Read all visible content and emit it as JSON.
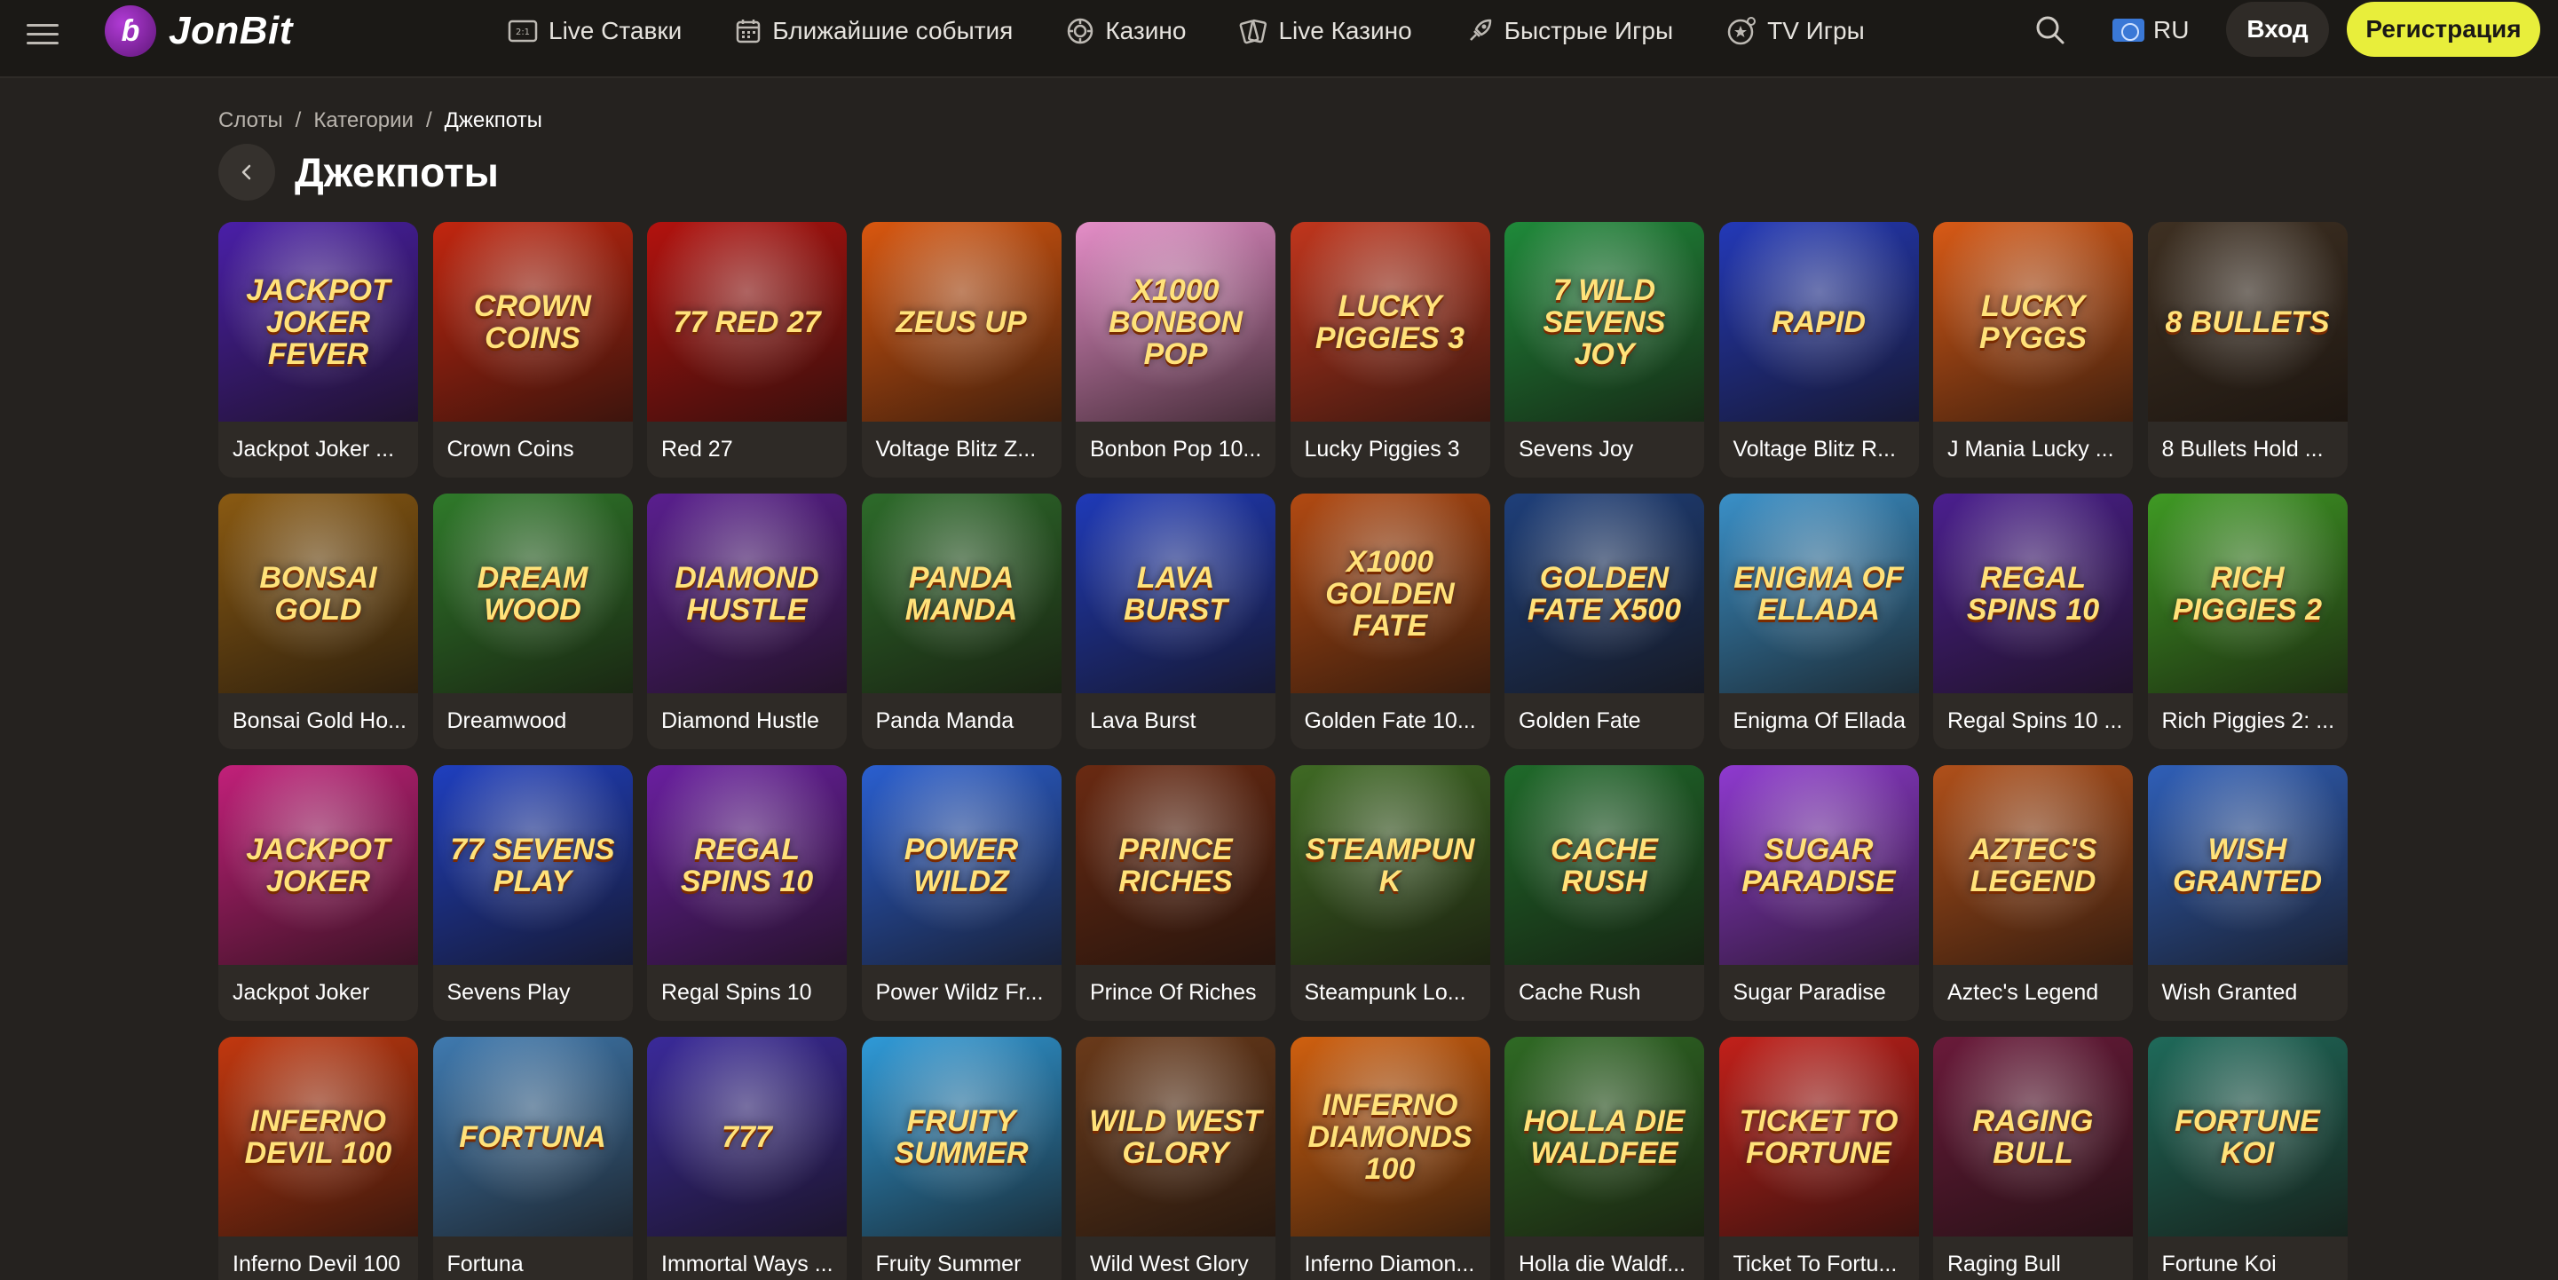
{
  "header": {
    "logo_text": "JonBit",
    "nav": [
      {
        "label": "Live Ставки",
        "icon": "live-bets-icon"
      },
      {
        "label": "Ближайшие события",
        "icon": "calendar-icon"
      },
      {
        "label": "Казино",
        "icon": "casino-chip-icon"
      },
      {
        "label": "Live Казино",
        "icon": "live-casino-cards-icon"
      },
      {
        "label": "Быстрые Игры",
        "icon": "rocket-icon"
      },
      {
        "label": "TV Игры",
        "icon": "tv-games-icon"
      }
    ],
    "language": "RU",
    "login_label": "Вход",
    "register_label": "Регистрация"
  },
  "breadcrumb": {
    "items": [
      "Слоты",
      "Категории"
    ],
    "current": "Джекпоты"
  },
  "page": {
    "title": "Джекпоты"
  },
  "games": [
    {
      "label": "Jackpot Joker ...",
      "art": "Jackpot Joker Fever",
      "color": "#4a1fa8"
    },
    {
      "label": "Crown Coins",
      "art": "Crown Coins",
      "color": "#c2260f"
    },
    {
      "label": "Red 27",
      "art": "77 Red 27",
      "color": "#b3120e"
    },
    {
      "label": "Voltage Blitz Z...",
      "art": "Zeus Up",
      "color": "#d9570f"
    },
    {
      "label": "Bonbon Pop 10...",
      "art": "x1000 Bonbon Pop",
      "color": "#e58ec8"
    },
    {
      "label": "Lucky Piggies 3",
      "art": "Lucky Piggies 3",
      "color": "#c1361d"
    },
    {
      "label": "Sevens Joy",
      "art": "7 Wild Sevens Joy",
      "color": "#1f8a3a"
    },
    {
      "label": "Voltage Blitz R...",
      "art": "Rapid",
      "color": "#2339b8"
    },
    {
      "label": "J Mania Lucky ...",
      "art": "Lucky Pyggs",
      "color": "#d85a16"
    },
    {
      "label": "8 Bullets Hold ...",
      "art": "8 Bullets",
      "color": "#3e3022"
    },
    {
      "label": "Bonsai Gold Ho...",
      "art": "Bonsai Gold",
      "color": "#8a5a12"
    },
    {
      "label": "Dreamwood",
      "art": "Dream Wood",
      "color": "#2f7a2a"
    },
    {
      "label": "Diamond Hustle",
      "art": "Diamond Hustle",
      "color": "#5a1f8f"
    },
    {
      "label": "Panda Manda",
      "art": "Panda Manda",
      "color": "#2d6b2a"
    },
    {
      "label": "Lava Burst",
      "art": "Lava Burst",
      "color": "#1f3ab8"
    },
    {
      "label": "Golden Fate 10...",
      "art": "x1000 Golden Fate",
      "color": "#b24a12"
    },
    {
      "label": "Golden Fate",
      "art": "Golden Fate x500",
      "color": "#1e3f7a"
    },
    {
      "label": "Enigma Of Ellada",
      "art": "Enigma of Ellada",
      "color": "#3a90c8"
    },
    {
      "label": "Regal Spins 10 ...",
      "art": "Regal Spins 10",
      "color": "#4b1f8f"
    },
    {
      "label": "Rich Piggies 2: ...",
      "art": "Rich Piggies 2",
      "color": "#3f9a24"
    },
    {
      "label": "Jackpot Joker",
      "art": "Jackpot Joker",
      "color": "#c2207a"
    },
    {
      "label": "Sevens Play",
      "art": "77 Sevens Play",
      "color": "#1f3fbf"
    },
    {
      "label": "Regal Spins 10",
      "art": "Regal Spins 10",
      "color": "#6a1fa0"
    },
    {
      "label": "Power Wildz Fr...",
      "art": "Power Wildz",
      "color": "#2a5fd0"
    },
    {
      "label": "Prince Of Riches",
      "art": "Prince Riches",
      "color": "#6a2a12"
    },
    {
      "label": "Steampunk Lo...",
      "art": "Steampunk",
      "color": "#3f6a24"
    },
    {
      "label": "Cache Rush",
      "art": "Cache Rush",
      "color": "#1f6a2a"
    },
    {
      "label": "Sugar Paradise",
      "art": "Sugar Paradise",
      "color": "#8f3ad0"
    },
    {
      "label": "Aztec's Legend",
      "art": "Aztec's Legend",
      "color": "#b0501a"
    },
    {
      "label": "Wish Granted",
      "art": "Wish Granted",
      "color": "#2f5fb8"
    },
    {
      "label": "Inferno Devil 100",
      "art": "Inferno Devil 100",
      "color": "#c2380f"
    },
    {
      "label": "Fortuna",
      "art": "Fortuna",
      "color": "#3f7ab0"
    },
    {
      "label": "Immortal Ways ...",
      "art": "777",
      "color": "#3a2a9a"
    },
    {
      "label": "Fruity Summer",
      "art": "Fruity Summer",
      "color": "#2f9ad8"
    },
    {
      "label": "Wild West Glory",
      "art": "Wild West Glory",
      "color": "#6a3a1a"
    },
    {
      "label": "Inferno Diamon...",
      "art": "Inferno Diamonds 100",
      "color": "#d0600f"
    },
    {
      "label": "Holla die Waldf...",
      "art": "Holla die Waldfee",
      "color": "#2f6a24"
    },
    {
      "label": "Ticket To Fortu...",
      "art": "Ticket to Fortune",
      "color": "#c2201a"
    },
    {
      "label": "Raging Bull",
      "art": "Raging Bull",
      "color": "#6a1a3a"
    },
    {
      "label": "Fortune Koi",
      "art": "Fortune Koi",
      "color": "#1f6a5a"
    }
  ],
  "colors": {
    "background": "#25221f",
    "header": "#1b1916",
    "accent": "#e8ee3b",
    "card": "#2e2a26"
  }
}
